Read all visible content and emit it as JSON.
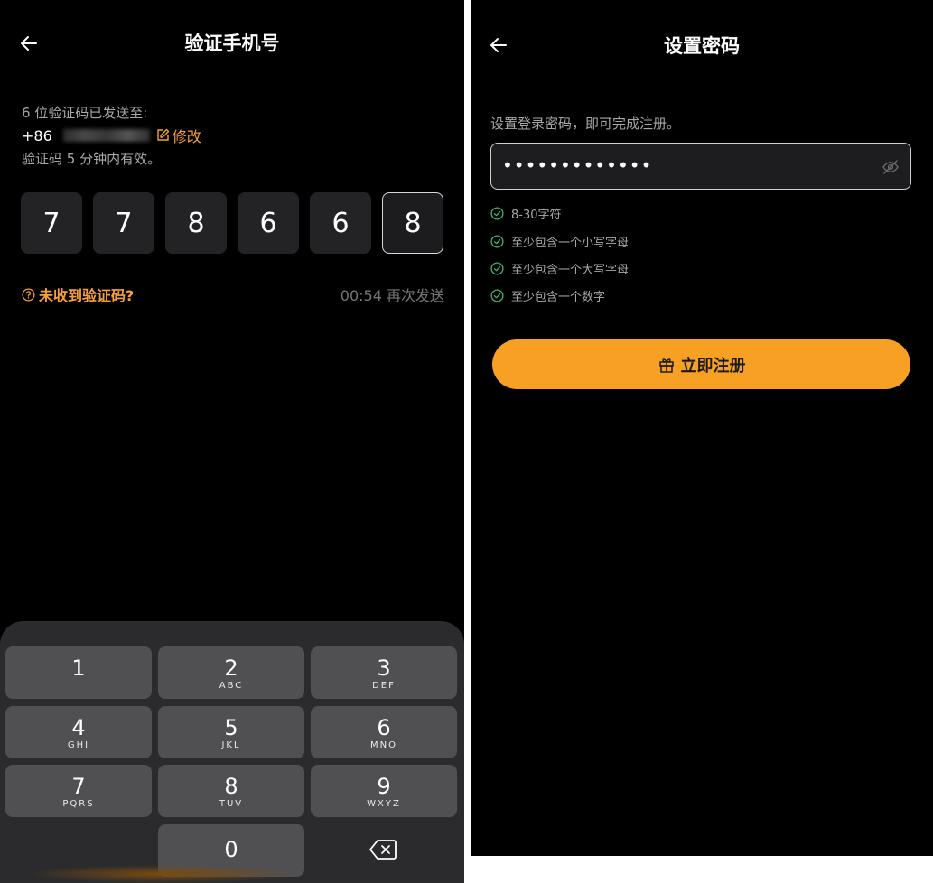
{
  "left": {
    "title": "验证手机号",
    "sent_line": "6 位验证码已发送至:",
    "country_code": "+86",
    "edit_label": "修改",
    "validity": "验证码 5 分钟内有效。",
    "code_digits": [
      "7",
      "7",
      "8",
      "6",
      "6",
      "8"
    ],
    "no_code_label": "未收到验证码?",
    "resend_label": "00:54 再次发送",
    "keypad": [
      {
        "num": "1",
        "letters": ""
      },
      {
        "num": "2",
        "letters": "ABC"
      },
      {
        "num": "3",
        "letters": "DEF"
      },
      {
        "num": "4",
        "letters": "GHI"
      },
      {
        "num": "5",
        "letters": "JKL"
      },
      {
        "num": "6",
        "letters": "MNO"
      },
      {
        "num": "7",
        "letters": "PQRS"
      },
      {
        "num": "8",
        "letters": "TUV"
      },
      {
        "num": "9",
        "letters": "WXYZ"
      },
      {
        "num": "0",
        "letters": ""
      }
    ]
  },
  "right": {
    "title": "设置密码",
    "hint": "设置登录密码，即可完成注册。",
    "password_mask": "•••••••••••••",
    "rules": [
      "8-30字符",
      "至少包含一个小写字母",
      "至少包含一个大写字母",
      "至少包含一个数字"
    ],
    "register_label": "立即注册"
  },
  "colors": {
    "accent": "#f7a03a",
    "button": "#f8a023",
    "success": "#3cb371",
    "background": "#000000"
  },
  "icons": [
    "back-arrow-icon",
    "edit-icon",
    "question-circle-icon",
    "backspace-icon",
    "eye-off-icon",
    "check-circle-icon",
    "gift-icon"
  ]
}
